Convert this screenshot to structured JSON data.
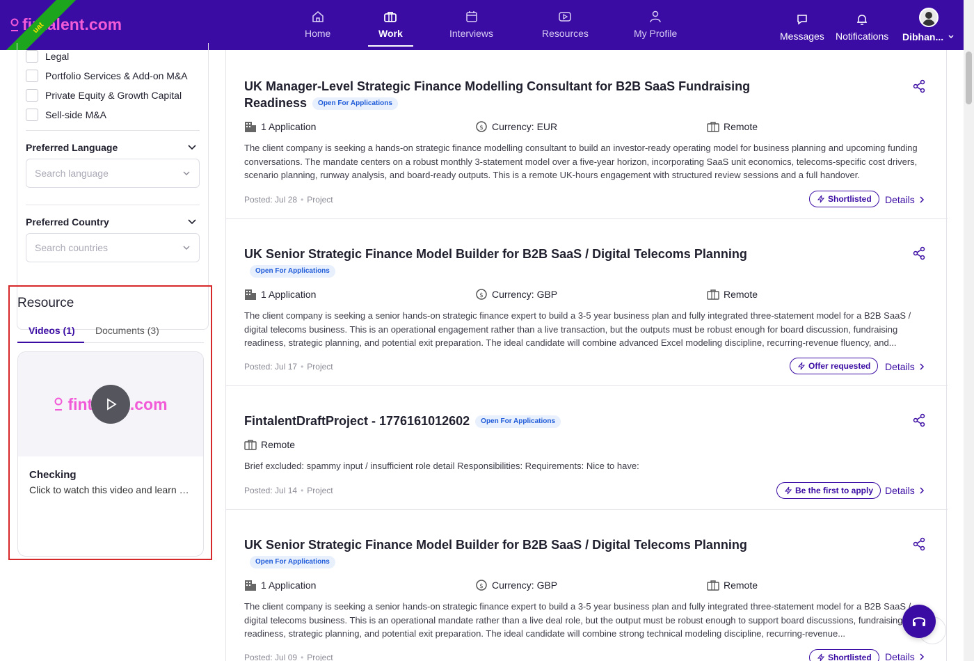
{
  "brand": {
    "logo_text": "fintalent.com",
    "env_ribbon": "uat"
  },
  "nav": {
    "items": [
      {
        "label": "Home",
        "icon": "home-icon"
      },
      {
        "label": "Work",
        "icon": "briefcase-icon",
        "active": true
      },
      {
        "label": "Interviews",
        "icon": "calendar-icon"
      },
      {
        "label": "Resources",
        "icon": "video-icon"
      },
      {
        "label": "My Profile",
        "icon": "user-icon"
      }
    ],
    "messages": "Messages",
    "notifications": "Notifications",
    "user_name": "Dibhan..."
  },
  "filters": {
    "checkboxes": [
      "Legal",
      "Portfolio Services & Add-on M&A",
      "Private Equity & Growth Capital",
      "Sell-side M&A"
    ],
    "language": {
      "title": "Preferred Language",
      "placeholder": "Search language"
    },
    "country": {
      "title": "Preferred Country",
      "placeholder": "Search countries"
    }
  },
  "resource": {
    "title": "Resource",
    "tabs": {
      "videos": "Videos (1)",
      "documents": "Documents (3)"
    },
    "video": {
      "thumb_logo": "fintalent.com",
      "title": "Checking",
      "description": "Click to watch this video and learn more"
    }
  },
  "jobs": [
    {
      "title": "UK Manager-Level Strategic Finance Modelling Consultant for B2B SaaS Fundraising Readiness",
      "badge": "Open For Applications",
      "applications": "1 Application",
      "currency": "Currency: EUR",
      "location": "Remote",
      "description": "The client company is seeking a hands-on strategic finance modelling consultant to build an investor-ready operating model for business planning and upcoming funding conversations. The mandate centers on a robust monthly 3-statement model over a five-year horizon, incorporating SaaS unit economics, telecoms-specific cost drivers, scenario planning, runway analysis, and board-ready outputs. This is a remote UK-hours engagement with structured review sessions and a full handover.",
      "posted": "Posted: Jul 28",
      "type": "Project",
      "status": "Shortlisted",
      "details": "Details"
    },
    {
      "title": "UK Senior Strategic Finance Model Builder for B2B SaaS / Digital Telecoms Planning",
      "badge": "Open For Applications",
      "applications": "1 Application",
      "currency": "Currency: GBP",
      "location": "Remote",
      "description": "The client company is seeking a senior hands-on strategic finance expert to build a 3-5 year business plan and fully integrated three-statement model for a B2B SaaS / digital telecoms business. This is an operational engagement rather than a live transaction, but the outputs must be robust enough for board discussion, fundraising readiness, strategic planning, and potential exit preparation. The ideal candidate will combine advanced Excel modeling discipline, recurring-revenue fluency, and...",
      "posted": "Posted: Jul 17",
      "type": "Project",
      "status": "Offer requested",
      "details": "Details"
    },
    {
      "title": "FintalentDraftProject - 1776161012602",
      "badge": "Open For Applications",
      "location": "Remote",
      "description": "Brief excluded: spammy input / insufficient role detail Responsibilities: Requirements: Nice to have:",
      "posted": "Posted: Jul 14",
      "type": "Project",
      "status": "Be the first to apply",
      "details": "Details"
    },
    {
      "title": "UK Senior Strategic Finance Model Builder for B2B SaaS / Digital Telecoms Planning",
      "badge": "Open For Applications",
      "applications": "1 Application",
      "currency": "Currency: GBP",
      "location": "Remote",
      "description": "The client company is seeking a senior hands-on strategic finance expert to build a 3-5 year business plan and fully integrated three-statement model for a B2B SaaS / digital telecoms business. This is an operational mandate rather than a live deal role, but the output must be robust enough to support board discussions, fundraising readiness, strategic planning, and potential exit preparation. The ideal candidate will combine strong technical modeling discipline, recurring-revenue...",
      "posted": "Posted: Jul 09",
      "type": "Project",
      "status": "Shortlisted",
      "details": "Details"
    }
  ],
  "colors": {
    "brand_purple": "#3a0ca3",
    "logo_pink": "#f15bd7",
    "highlight_red": "#d62828",
    "uat_green": "#1ea51e"
  }
}
